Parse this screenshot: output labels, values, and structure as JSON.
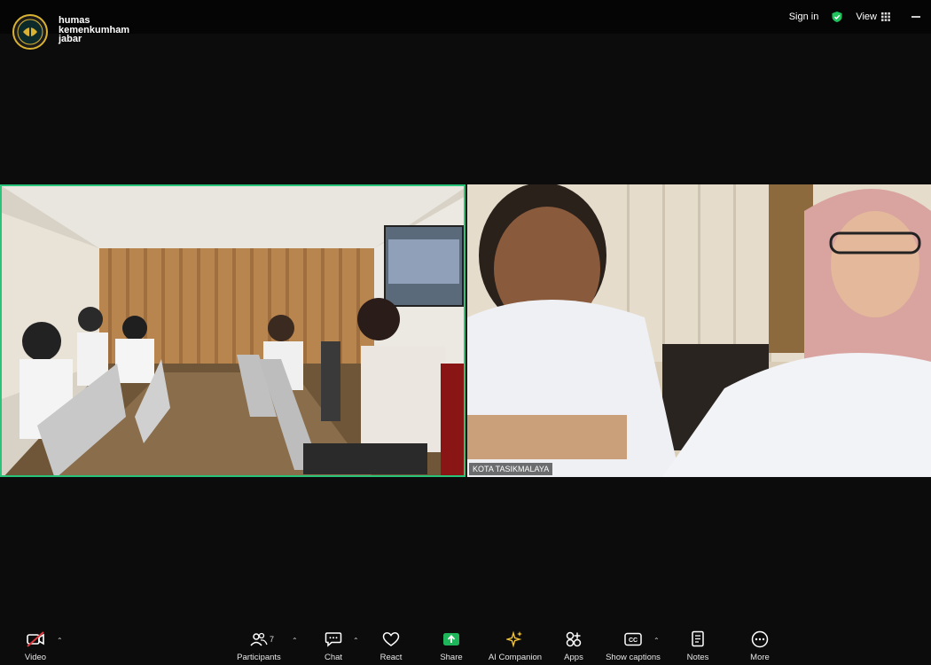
{
  "header": {
    "org_name": "humas\nkemenkumham\njabar",
    "sign_in": "Sign in",
    "view": "View"
  },
  "tiles": {
    "right_name": "KOTA TASIKMALAYA"
  },
  "toolbar": {
    "video": "Video",
    "participants": "Participants",
    "participants_count": "7",
    "chat": "Chat",
    "react": "React",
    "share": "Share",
    "ai_companion": "AI Companion",
    "apps": "Apps",
    "show_captions": "Show captions",
    "notes": "Notes",
    "more": "More"
  },
  "colors": {
    "active_speaker_border": "#27c47a",
    "share_green": "#1fb55a",
    "video_off_red": "#e0393e",
    "ai_yellow": "#f2c23a",
    "shield_green": "#1fc45f"
  }
}
